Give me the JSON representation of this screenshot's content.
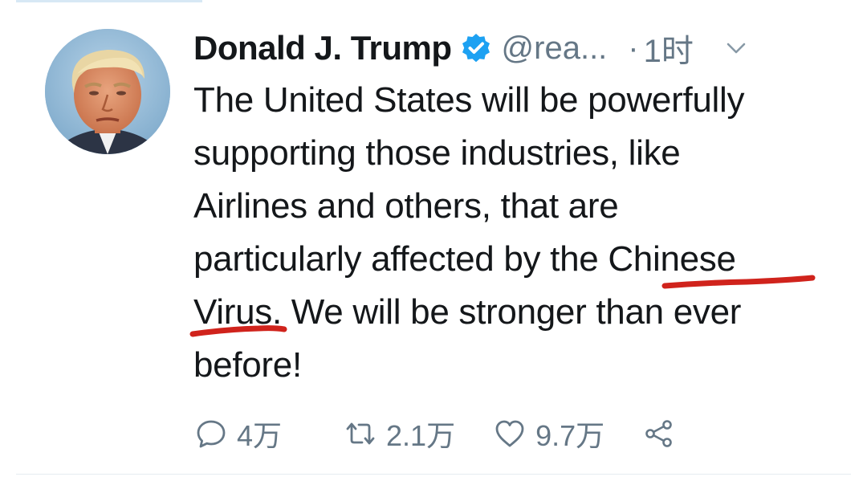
{
  "tweet": {
    "author": {
      "display_name": "Donald J. Trump",
      "handle": "@rea...",
      "verified": true
    },
    "separator": "·",
    "timestamp": "1时",
    "text_lines": [
      "The United States will be powerfully",
      "supporting those industries, like",
      "Airlines and others, that are",
      "particularly affected by the Chinese",
      "Virus. We will be stronger than ever",
      "before!"
    ],
    "highlight_color": "#d0231c"
  },
  "actions": {
    "reply_count": "4万",
    "retweet_count": "2.1万",
    "like_count": "9.7万"
  },
  "icons": {
    "verified": "verified-badge-icon",
    "caret": "chevron-down-icon",
    "reply": "reply-icon",
    "retweet": "retweet-icon",
    "like": "heart-icon",
    "share": "share-icon"
  },
  "colors": {
    "text": "#14171a",
    "secondary": "#657786",
    "verified_blue": "#1da1f2"
  }
}
